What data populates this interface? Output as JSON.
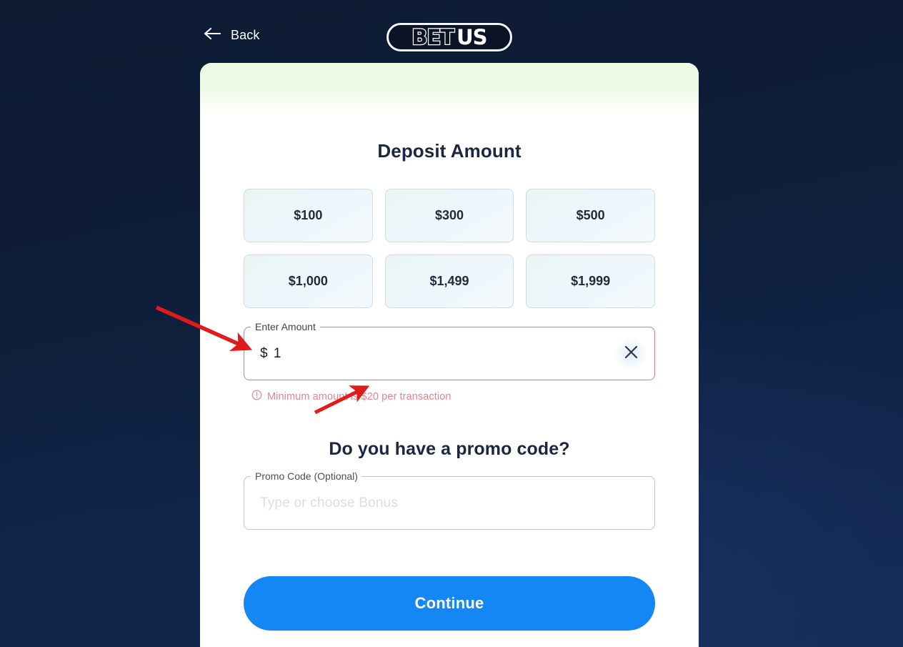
{
  "header": {
    "back_label": "Back",
    "back_icon": "arrow-left-icon",
    "logo": {
      "part1": "BET",
      "part2": "US"
    }
  },
  "deposit": {
    "title": "Deposit Amount",
    "preset_amounts": [
      "$100",
      "$300",
      "$500",
      "$1,000",
      "$1,499",
      "$1,999"
    ],
    "amount_field": {
      "legend": "Enter Amount",
      "value": "$ 1",
      "clear_icon": "close-icon",
      "state": "error"
    },
    "error": {
      "icon": "exclamation-circle-icon",
      "text": "Minimum amount is $20 per transaction"
    }
  },
  "promo": {
    "title": "Do you have a promo code?",
    "field": {
      "legend": "Promo Code (Optional)",
      "placeholder": "Type or choose Bonus",
      "value": ""
    }
  },
  "footer": {
    "continue_label": "Continue"
  },
  "colors": {
    "page_background": "#0d1b33",
    "card_background": "#ffffff",
    "banner_green": "#edf9e3",
    "accent_blue": "#1487f5",
    "error_red": "#e8838c",
    "heading_navy": "#1c2541",
    "annotation_red": "#e01b1b"
  },
  "annotations": [
    {
      "name": "arrow-to-amount-field",
      "color": "#e01b1b"
    },
    {
      "name": "arrow-to-error-message",
      "color": "#e01b1b"
    }
  ]
}
